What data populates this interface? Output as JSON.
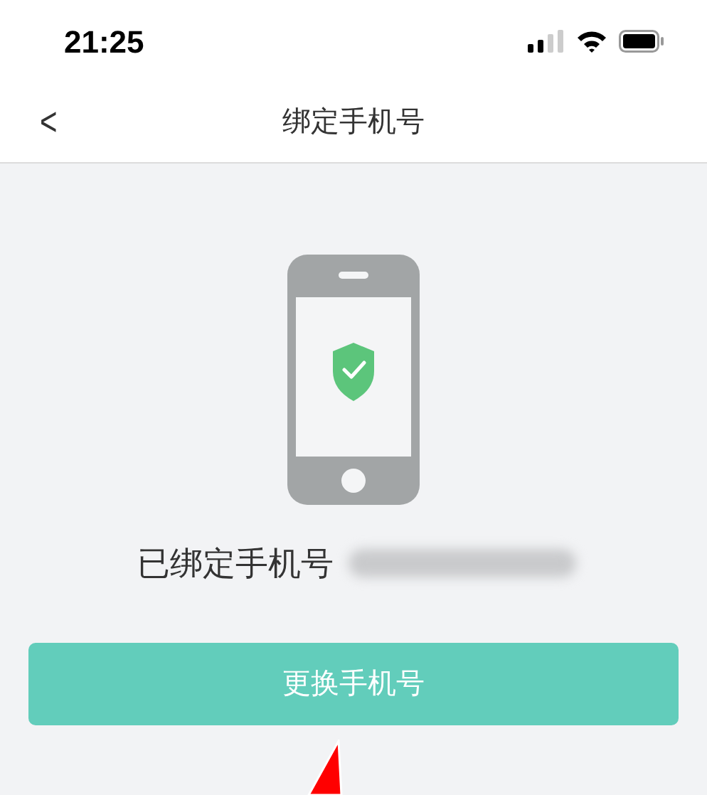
{
  "status_bar": {
    "time": "21:25"
  },
  "nav_bar": {
    "back": "<",
    "title": "绑定手机号"
  },
  "bound_label": "已绑定手机号",
  "button": "更换手机号"
}
